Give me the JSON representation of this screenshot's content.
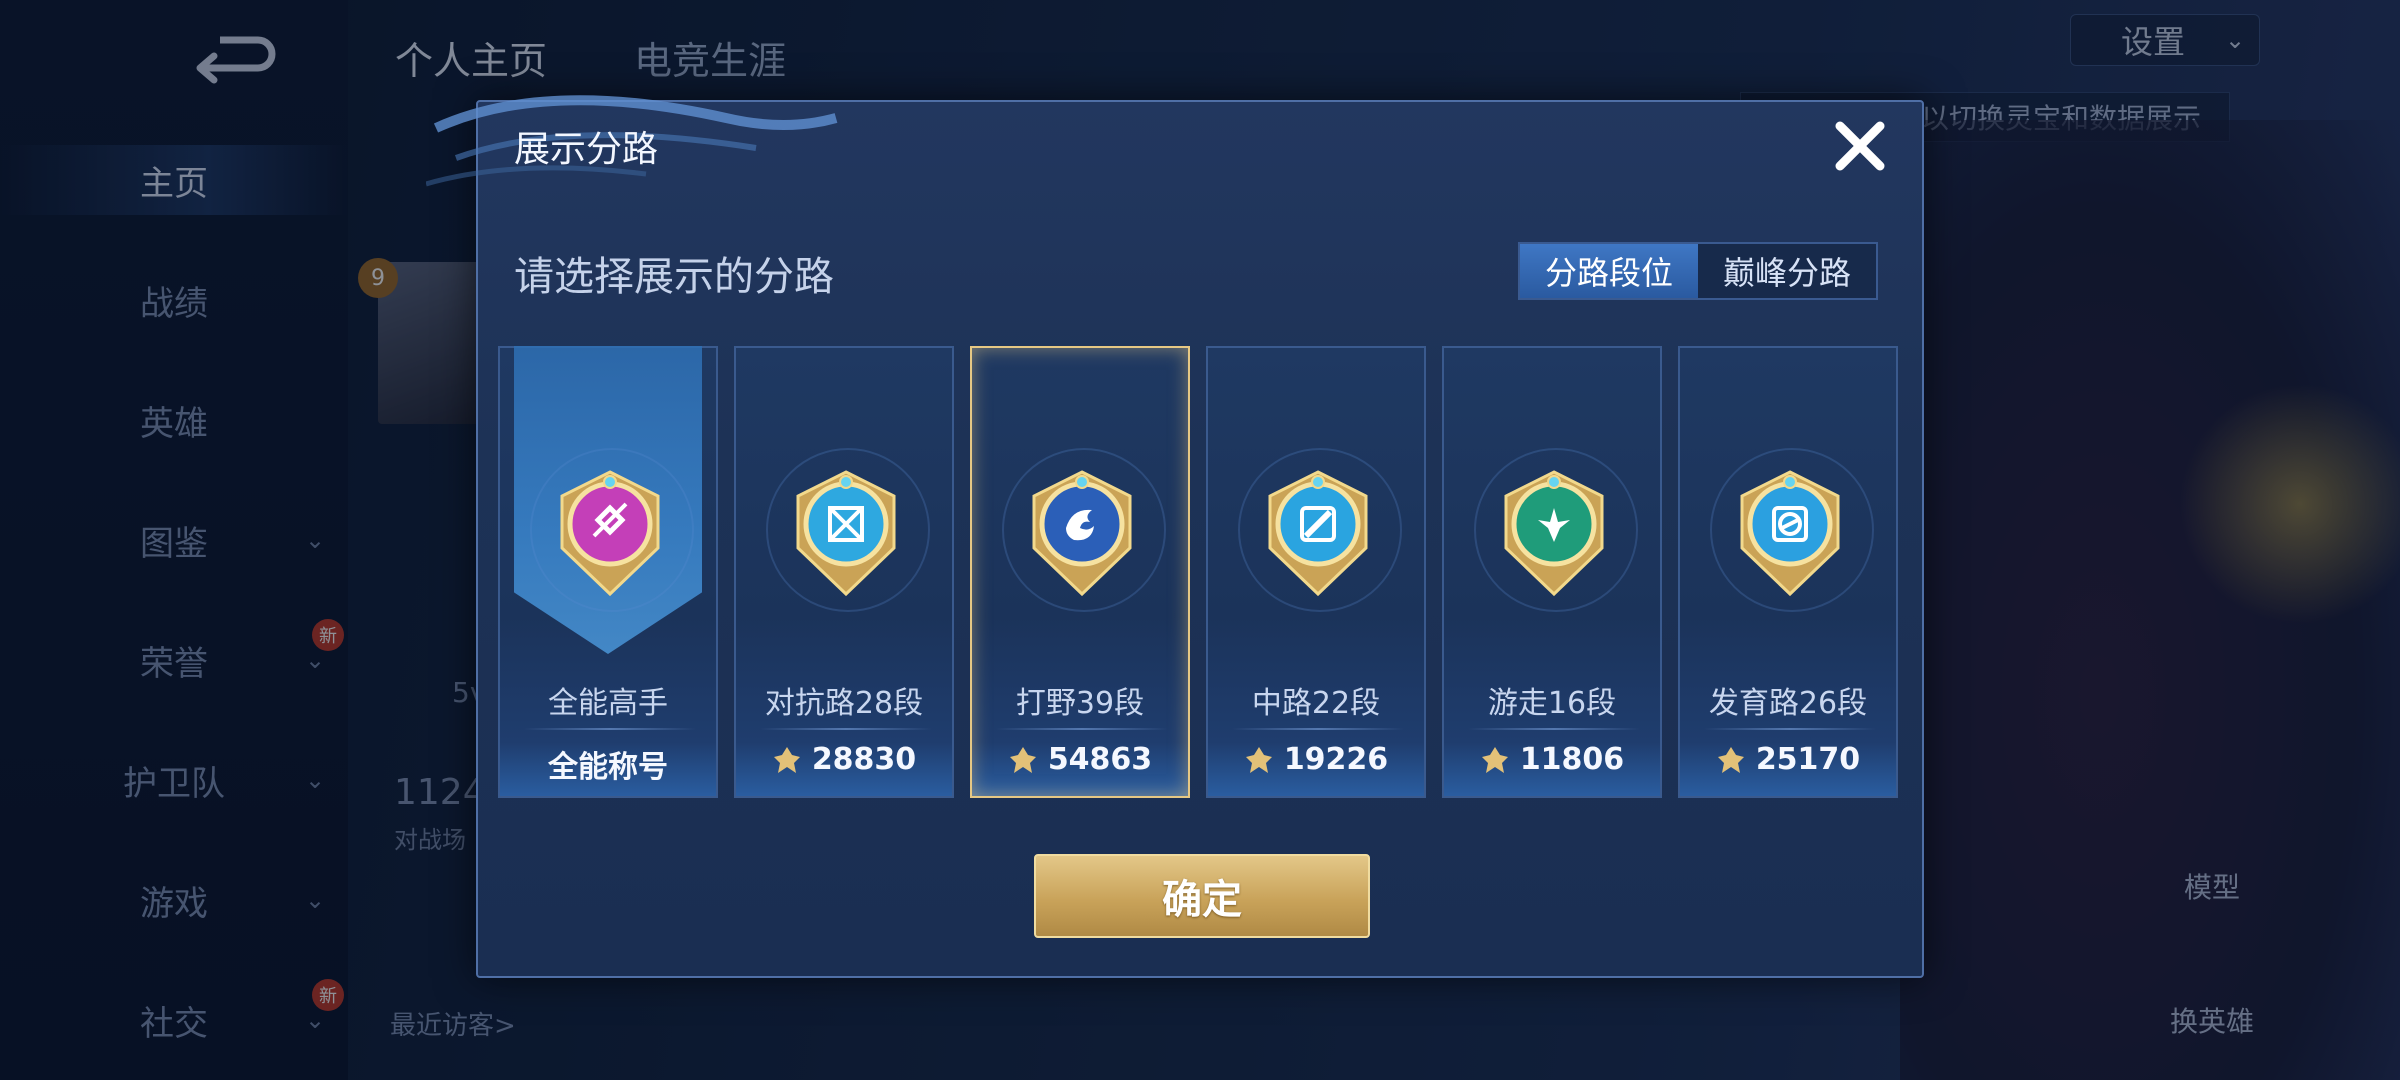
{
  "background": {
    "sidebar": {
      "items": [
        {
          "label": "主页",
          "active": true,
          "chevron": false,
          "new": false
        },
        {
          "label": "战绩",
          "active": false,
          "chevron": false,
          "new": false
        },
        {
          "label": "英雄",
          "active": false,
          "chevron": false,
          "new": false
        },
        {
          "label": "图鉴",
          "active": false,
          "chevron": true,
          "new": false
        },
        {
          "label": "荣誉",
          "active": false,
          "chevron": true,
          "new": true
        },
        {
          "label": "护卫队",
          "active": false,
          "chevron": true,
          "new": false
        },
        {
          "label": "游戏",
          "active": false,
          "chevron": true,
          "new": false
        },
        {
          "label": "社交",
          "active": false,
          "chevron": true,
          "new": true
        }
      ],
      "new_badge": "新",
      "chevron": "⌄"
    },
    "tabs": [
      "个人主页",
      "电竞生涯"
    ],
    "settings_label": "设置",
    "hint_text": "以切换灵宝和数据展示",
    "level": "9",
    "stat_partial": "1124",
    "stat_caption": "对战场",
    "visitors_label": "最近访客>",
    "model_label": "模型",
    "swap_hero_label": "换英雄",
    "side_text": "5v"
  },
  "dialog": {
    "title": "展示分路",
    "subtitle": "请选择展示的分路",
    "toggle": [
      {
        "label": "分路段位",
        "active": true
      },
      {
        "label": "巅峰分路",
        "active": false
      }
    ],
    "cards": [
      {
        "label": "全能高手",
        "score": "全能称号",
        "medal": "all-round-medal-icon",
        "color": "#c43fb8",
        "selected": false,
        "has_banner": true,
        "has_points_icon": false
      },
      {
        "label": "对抗路28段",
        "score": "28830",
        "medal": "clash-lane-medal-icon",
        "color": "#2ea8e0",
        "selected": false,
        "has_banner": false,
        "has_points_icon": true
      },
      {
        "label": "打野39段",
        "score": "54863",
        "medal": "jungle-medal-icon",
        "color": "#2b5fb8",
        "selected": true,
        "has_banner": false,
        "has_points_icon": true
      },
      {
        "label": "中路22段",
        "score": "19226",
        "medal": "mid-lane-medal-icon",
        "color": "#2aa4e0",
        "selected": false,
        "has_banner": false,
        "has_points_icon": true
      },
      {
        "label": "游走16段",
        "score": "11806",
        "medal": "roam-medal-icon",
        "color": "#1f9c7a",
        "selected": false,
        "has_banner": false,
        "has_points_icon": true
      },
      {
        "label": "发育路26段",
        "score": "25170",
        "medal": "farm-lane-medal-icon",
        "color": "#2ba0e0",
        "selected": false,
        "has_banner": false,
        "has_points_icon": true
      }
    ],
    "confirm_label": "确定"
  }
}
